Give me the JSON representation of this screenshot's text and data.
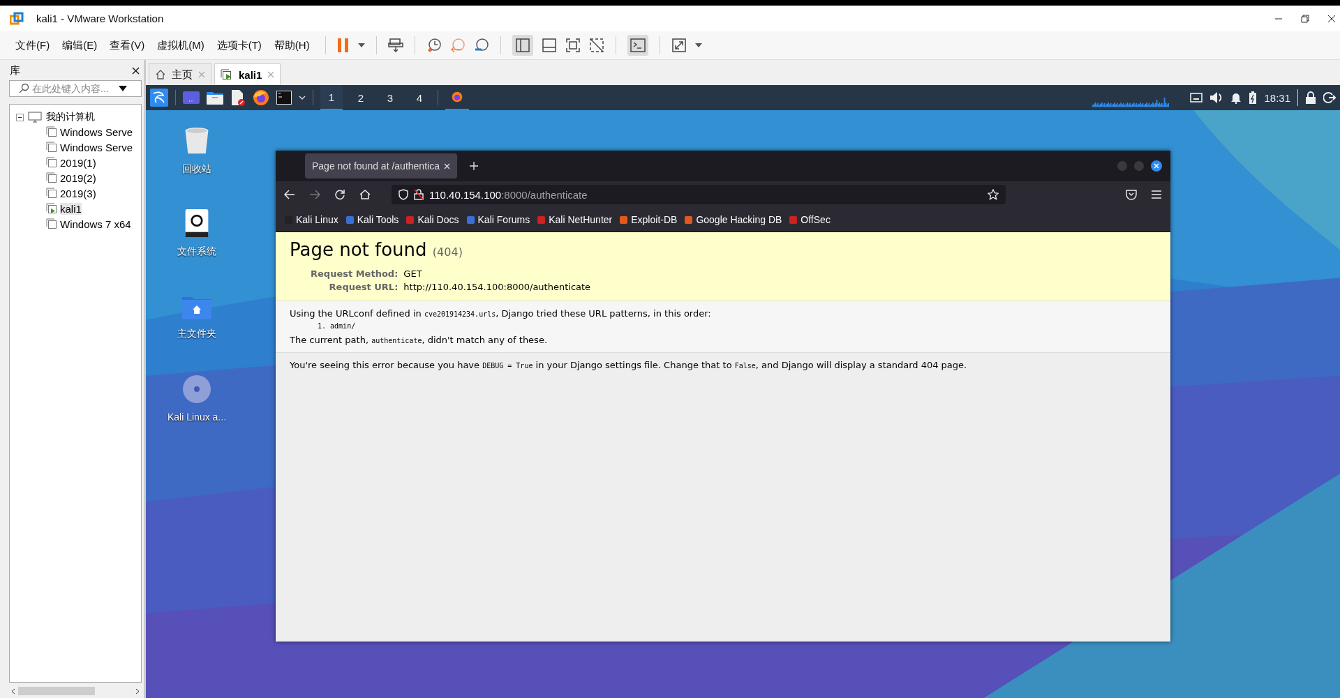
{
  "window": {
    "title": "kali1 - VMware Workstation"
  },
  "menu": [
    "文件(F)",
    "编辑(E)",
    "查看(V)",
    "虚拟机(M)",
    "选项卡(T)",
    "帮助(H)"
  ],
  "library": {
    "title": "库",
    "search": {
      "placeholder": "在此处键入内容..."
    },
    "tree": {
      "label": "我的计算机",
      "expanded": true,
      "children": [
        {
          "label": "Windows Serve",
          "running": false,
          "selected": false
        },
        {
          "label": "Windows Serve",
          "running": false,
          "selected": false
        },
        {
          "label": "2019(1)",
          "running": false,
          "selected": false
        },
        {
          "label": "2019(2)",
          "running": false,
          "selected": false
        },
        {
          "label": "2019(3)",
          "running": false,
          "selected": false
        },
        {
          "label": "kali1",
          "running": true,
          "selected": true
        },
        {
          "label": "Windows 7 x64",
          "running": false,
          "selected": false
        }
      ]
    }
  },
  "vm_tabs": [
    {
      "label": "主页",
      "kind": "home",
      "selected": false
    },
    {
      "label": "kali1",
      "kind": "vm",
      "selected": true
    }
  ],
  "kali_panel": {
    "workspaces": [
      {
        "label": "1",
        "selected": true
      },
      {
        "label": "2",
        "selected": false
      },
      {
        "label": "3",
        "selected": false
      },
      {
        "label": "4",
        "selected": false
      }
    ],
    "clock": "18:31"
  },
  "desktop_icons": [
    {
      "label": "回收站",
      "kind": "trash"
    },
    {
      "label": "文件系统",
      "kind": "drive"
    },
    {
      "label": "主文件夹",
      "kind": "home"
    },
    {
      "label": "Kali Linux a...",
      "kind": "disc"
    }
  ],
  "browser": {
    "tab_title": "Page not found at /authentica",
    "address": {
      "host": "110.40.154.100",
      "rest": ":8000/authenticate"
    },
    "bookmarks": [
      "Kali Linux",
      "Kali Tools",
      "Kali Docs",
      "Kali Forums",
      "Kali NetHunter",
      "Exploit-DB",
      "Google Hacking DB",
      "OffSec"
    ],
    "page": {
      "title": "Page not found",
      "code": "(404)",
      "fields": [
        {
          "label": "Request Method:",
          "value": "GET"
        },
        {
          "label": "Request URL:",
          "value": "http://110.40.154.100:8000/authenticate"
        }
      ],
      "urlconf": [
        {
          "kind": "text",
          "text": "Using the URLconf defined in "
        },
        {
          "kind": "code",
          "text": "cve201914234.urls"
        },
        {
          "kind": "text",
          "text": ", Django tried these URL patterns, in this order:"
        }
      ],
      "patterns": [
        {
          "marker": "1.",
          "text": "admin/"
        }
      ],
      "current_path": [
        {
          "kind": "text",
          "text": "The current path, "
        },
        {
          "kind": "code",
          "text": "authenticate"
        },
        {
          "kind": "text",
          "text": ", didn't match any of these."
        }
      ],
      "debug_note": [
        {
          "kind": "text",
          "text": "You're seeing this error because you have "
        },
        {
          "kind": "code",
          "text": "DEBUG = True"
        },
        {
          "kind": "text",
          "text": " in your Django settings file. Change that to "
        },
        {
          "kind": "code",
          "text": "False"
        },
        {
          "kind": "text",
          "text": ", and Django will display a standard 404 page."
        }
      ]
    }
  }
}
